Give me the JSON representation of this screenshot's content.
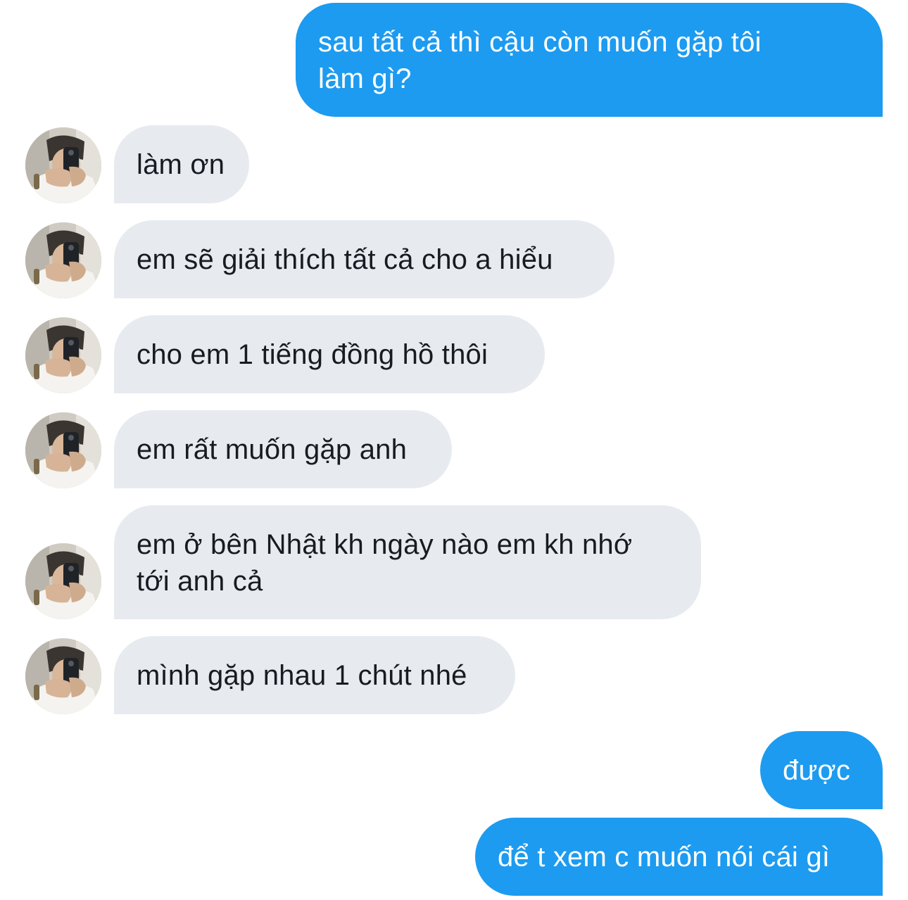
{
  "messages": [
    {
      "id": "m1",
      "side": "out",
      "lines": [
        "sau tất cả thì cậu còn muốn gặp tôi",
        "làm gì?"
      ]
    },
    {
      "id": "m2",
      "side": "in",
      "avatar": "avatar-photo",
      "lines": [
        "làm ơn"
      ]
    },
    {
      "id": "m3",
      "side": "in",
      "avatar": "avatar-photo",
      "lines": [
        "em sẽ giải thích tất cả cho a hiểu"
      ]
    },
    {
      "id": "m4",
      "side": "in",
      "avatar": "avatar-photo",
      "lines": [
        "cho em 1 tiếng đồng hồ thôi"
      ]
    },
    {
      "id": "m5",
      "side": "in",
      "avatar": "avatar-photo",
      "lines": [
        "em rất muốn gặp anh"
      ]
    },
    {
      "id": "m6",
      "side": "in",
      "avatar": "avatar-photo",
      "lines": [
        "em ở bên Nhật kh ngày nào em kh nhớ",
        "tới anh cả"
      ]
    },
    {
      "id": "m7",
      "side": "in",
      "avatar": "avatar-photo",
      "lines": [
        "mình gặp nhau 1 chút nhé"
      ]
    },
    {
      "id": "m8",
      "side": "out",
      "lines": [
        "được"
      ]
    },
    {
      "id": "m9",
      "side": "out",
      "lines": [
        "để t xem c muốn nói cái gì"
      ]
    }
  ],
  "colors": {
    "outgoing_bubble": "#1d9bf0",
    "outgoing_text": "#ffffff",
    "incoming_bubble": "#e7ebf0",
    "incoming_text": "#171c22",
    "background": "#ffffff"
  }
}
